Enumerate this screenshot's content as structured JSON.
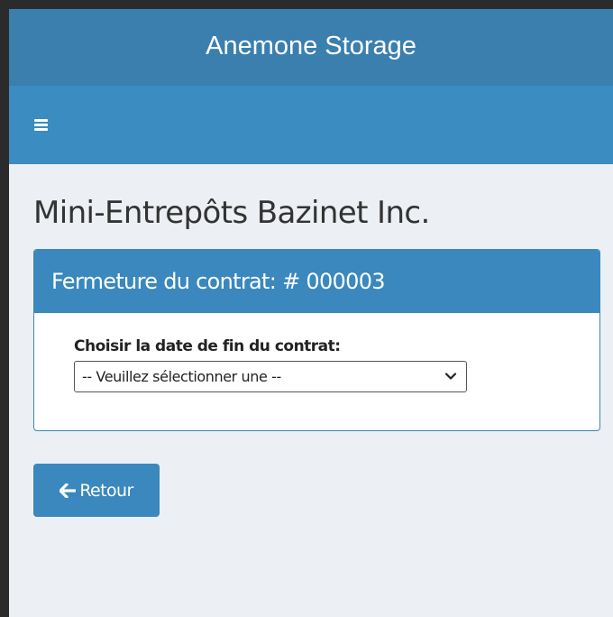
{
  "app": {
    "title": "Anemone Storage"
  },
  "navbar": {
    "menu_icon": "hamburger-menu-icon"
  },
  "page": {
    "company_name": "Mini-Entrepôts Bazinet Inc."
  },
  "card": {
    "title": "Fermeture du contrat: # 000003",
    "field_label": "Choisir la date de fin du contrat:",
    "select": {
      "selected_value": "-- Veuillez sélectionner une --",
      "icon": "chevron-down-icon"
    }
  },
  "actions": {
    "back_label": "Retour",
    "back_icon": "arrow-left-icon"
  },
  "colors": {
    "header_bg": "#3a7fae",
    "navbar_bg": "#3a8cc1",
    "primary": "#3a88bd",
    "page_bg": "#eceff3"
  }
}
